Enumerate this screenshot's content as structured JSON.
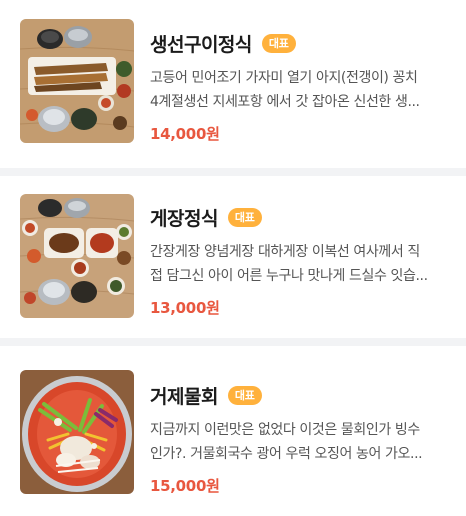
{
  "menu_items": [
    {
      "name": "생선구이정식",
      "badge": "대표",
      "desc_line1": "고등어 민어조기 가자미 열기 아지(전갱이) 꽁치",
      "desc_line2": "4계절생선 지세포항 에서 갓 잡아온 신선한 생...",
      "price": "14,000원",
      "image_icon": "grilled-fish-set-photo"
    },
    {
      "name": "게장정식",
      "badge": "대표",
      "desc_line1": "간장게장 양념게장 대하게장 이복선 여사께서 직",
      "desc_line2": "접 담그신 아이 어른 누구나 맛나게 드실수 잇습...",
      "price": "13,000원",
      "image_icon": "crab-set-photo"
    },
    {
      "name": "거제물회",
      "badge": "대표",
      "desc_line1": "지금까지 이런맛은 없었다 이것은 물회인가 빙수",
      "desc_line2": "인가?. 거물회국수 광어 우럭 오징어 농어 가오...",
      "price": "15,000원",
      "image_icon": "cold-raw-fish-soup-photo"
    }
  ],
  "colors": {
    "badge": "#ffb13c",
    "price": "#e8573f",
    "divider": "#f2f3f5"
  }
}
